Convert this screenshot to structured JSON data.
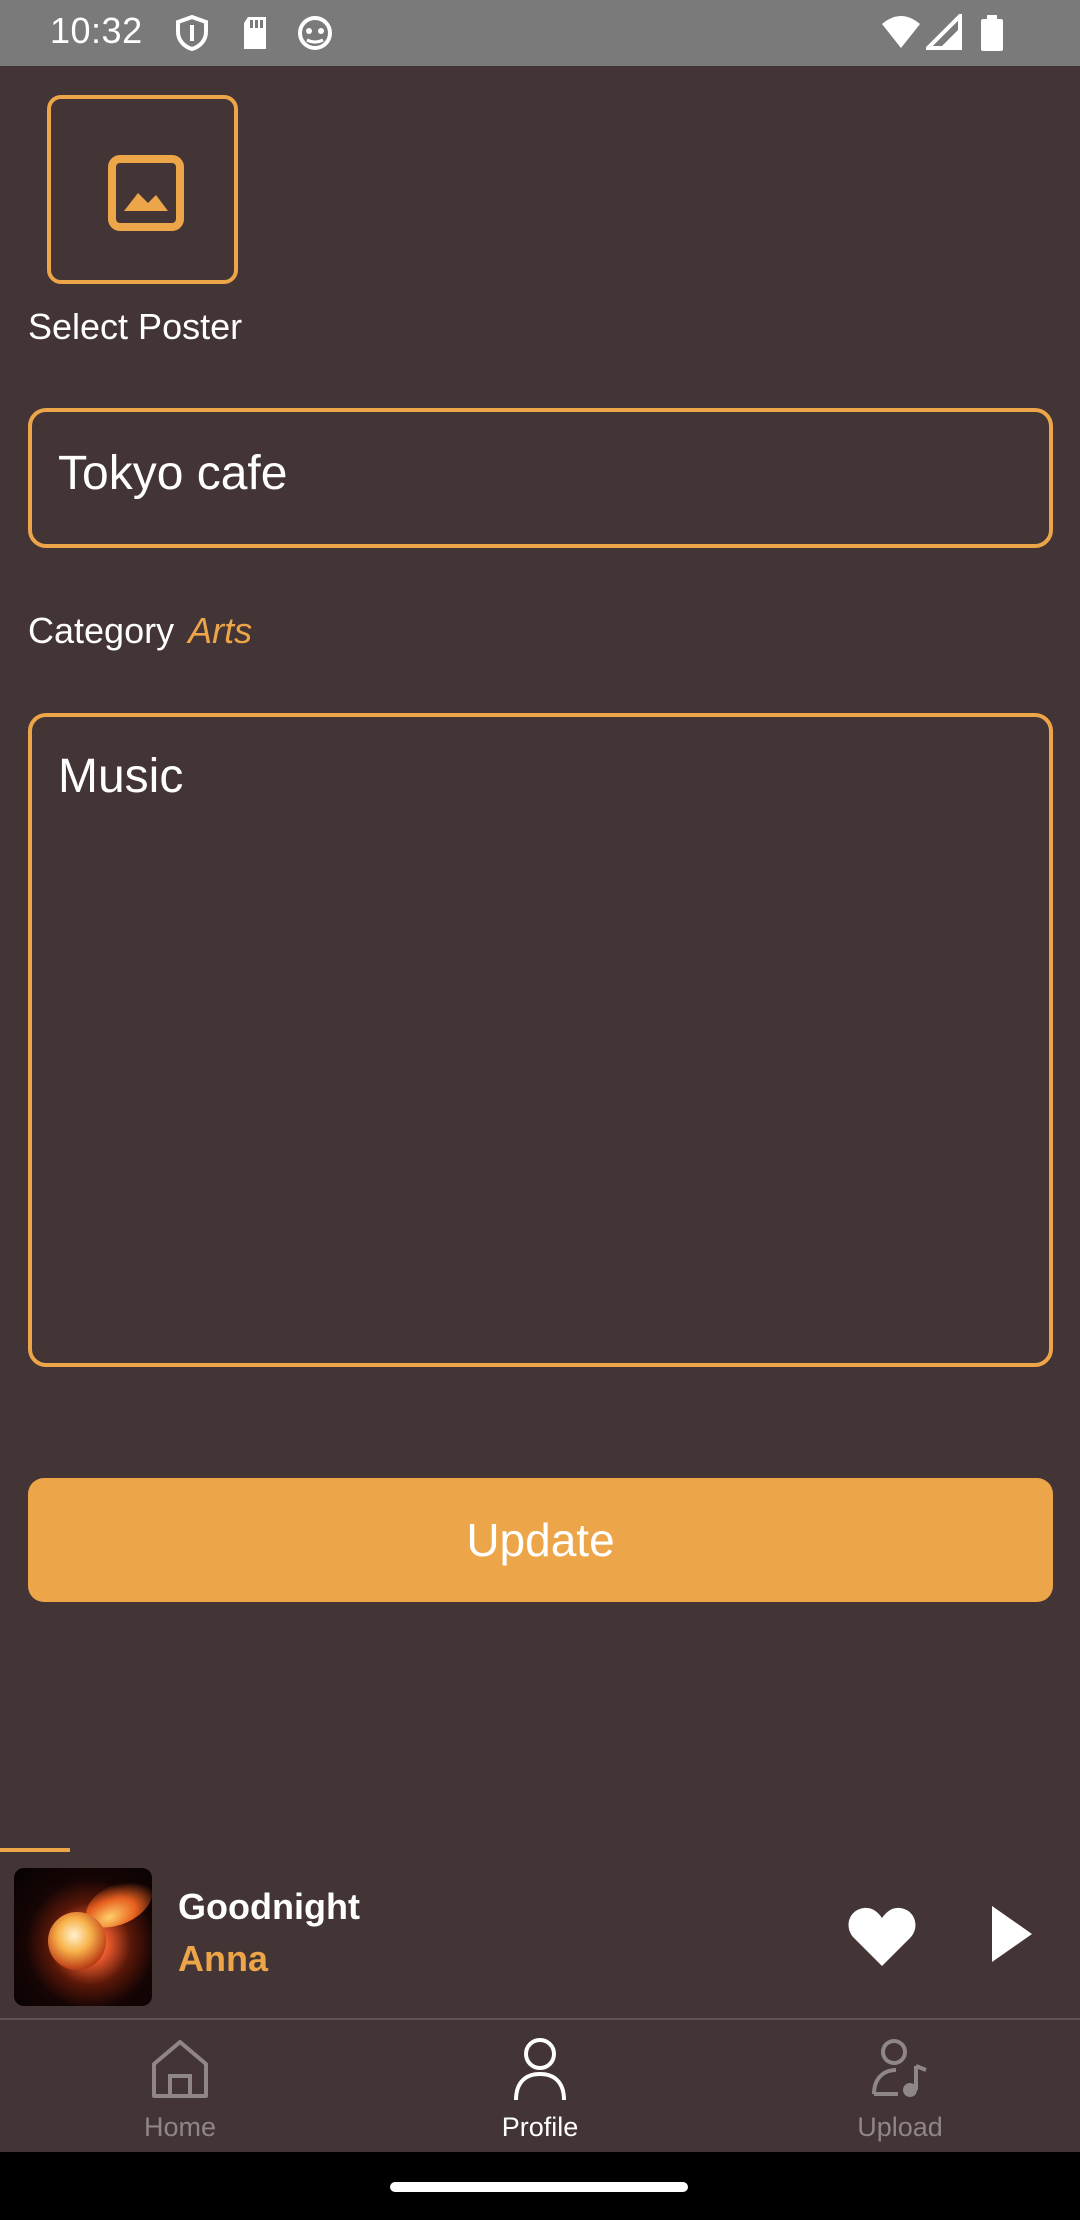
{
  "status_bar": {
    "time": "10:32"
  },
  "poster": {
    "label": "Select Poster",
    "icon": "image-icon"
  },
  "form": {
    "title_value": "Tokyo cafe",
    "category_label": "Category",
    "category_value": "Arts",
    "description_value": "Music",
    "update_label": "Update"
  },
  "player": {
    "track_title": "Goodnight",
    "artist": "Anna",
    "progress_fraction": 0.065
  },
  "nav": {
    "items": [
      {
        "label": "Home",
        "icon": "home-icon",
        "active": false
      },
      {
        "label": "Profile",
        "icon": "person-icon",
        "active": true
      },
      {
        "label": "Upload",
        "icon": "upload-icon",
        "active": false
      }
    ]
  },
  "colors": {
    "background": "#433435",
    "accent": "#eca548",
    "status_bar": "#7a7a7a",
    "inactive_nav": "#8e8687"
  }
}
